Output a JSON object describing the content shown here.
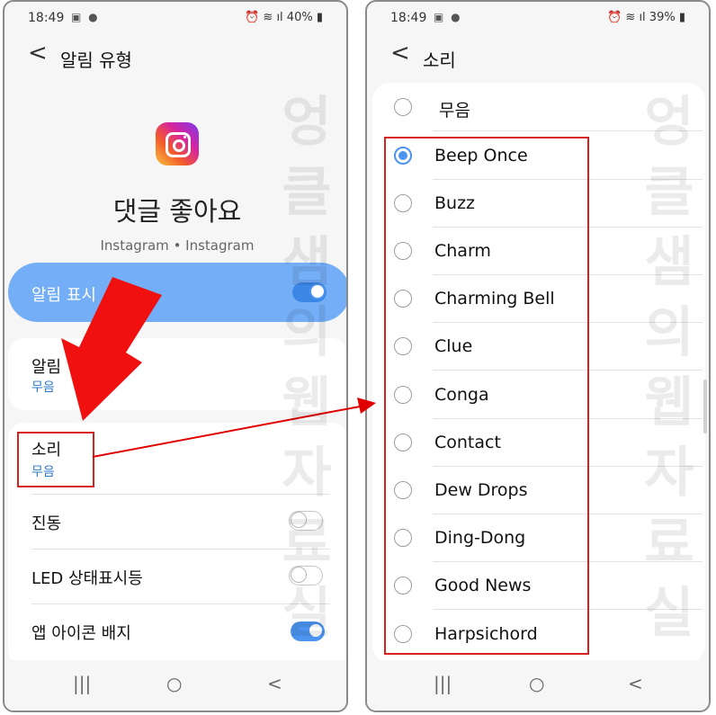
{
  "left": {
    "status": {
      "time": "18:49",
      "battery": "40%"
    },
    "header": {
      "back": "<",
      "title": "알림 유형"
    },
    "app": {
      "channel_name": "댓글 좋아요",
      "subtitle": "Instagram • Instagram"
    },
    "show_alerts": {
      "label": "알림 표시",
      "enabled": true
    },
    "alert_item": {
      "label": "알림",
      "value": "무음"
    },
    "sound_item": {
      "label": "소리",
      "value": "무음"
    },
    "vibration": {
      "label": "진동",
      "enabled": false
    },
    "led": {
      "label": "LED 상태표시등",
      "enabled": false
    },
    "badge": {
      "label": "앱 아이콘 배지",
      "enabled": true
    }
  },
  "right": {
    "status": {
      "time": "18:49",
      "battery": "39%"
    },
    "header": {
      "back": "<",
      "title": "소리"
    },
    "options": [
      "무음",
      "Beep Once",
      "Buzz",
      "Charm",
      "Charming Bell",
      "Clue",
      "Conga",
      "Contact",
      "Dew Drops",
      "Ding-Dong",
      "Good News",
      "Harpsichord"
    ],
    "selected": "Beep Once"
  },
  "nav": {
    "recents": "|||",
    "home": "○",
    "back": "<"
  },
  "watermark": "엉클샘의웹자료실",
  "colors": {
    "accent": "#4b94ef",
    "highlight": "#74aef6",
    "annotation_red": "#e00000",
    "value_blue": "#2f78c8"
  }
}
